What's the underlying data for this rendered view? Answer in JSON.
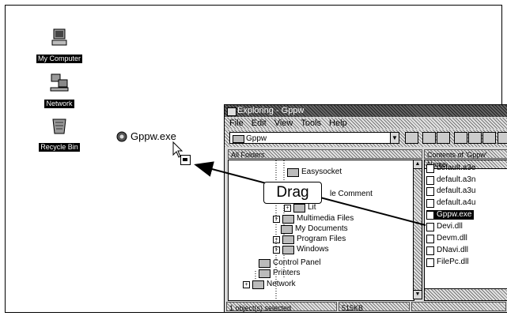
{
  "desktop": {
    "icons": [
      {
        "label": "My Computer",
        "icon": "computer-icon"
      },
      {
        "label": "Network",
        "icon": "network-icon"
      },
      {
        "label": "Recycle Bin",
        "icon": "recycle-bin-icon"
      }
    ],
    "dragged_file": {
      "label": "Gppw.exe",
      "icon": "application-icon"
    }
  },
  "explorer": {
    "title": "Exploring - Gppw",
    "menu": [
      "File",
      "Edit",
      "View",
      "Tools",
      "Help"
    ],
    "address": "Gppw",
    "left_header": "All Folders",
    "right_header": "Contents of 'Gppw'",
    "tree": [
      {
        "label": "Easysocket",
        "expander": ""
      },
      {
        "label": "le Comment",
        "expander": ""
      },
      {
        "label": "Lit",
        "expander": "+"
      },
      {
        "label": "Multimedia Files",
        "expander": "+"
      },
      {
        "label": "My Documents",
        "expander": ""
      },
      {
        "label": "Program Files",
        "expander": "+"
      },
      {
        "label": "Windows",
        "expander": "+"
      },
      {
        "label": "Control Panel",
        "expander": ""
      },
      {
        "label": "Printers",
        "expander": ""
      },
      {
        "label": "Network",
        "expander": "+"
      }
    ],
    "files_header": "Name",
    "files": [
      {
        "name": "default.a3e",
        "selected": false
      },
      {
        "name": "default.a3n",
        "selected": false
      },
      {
        "name": "default.a3u",
        "selected": false
      },
      {
        "name": "default.a4u",
        "selected": false
      },
      {
        "name": "Gppw.exe",
        "selected": true
      },
      {
        "name": "Devi.dll",
        "selected": false
      },
      {
        "name": "Devm.dll",
        "selected": false
      },
      {
        "name": "DNavi.dll",
        "selected": false
      },
      {
        "name": "FilePc.dll",
        "selected": false
      }
    ],
    "status": {
      "selection": "1 object(s) selected",
      "size": "515KB"
    }
  },
  "annotation": {
    "label": "Drag"
  }
}
